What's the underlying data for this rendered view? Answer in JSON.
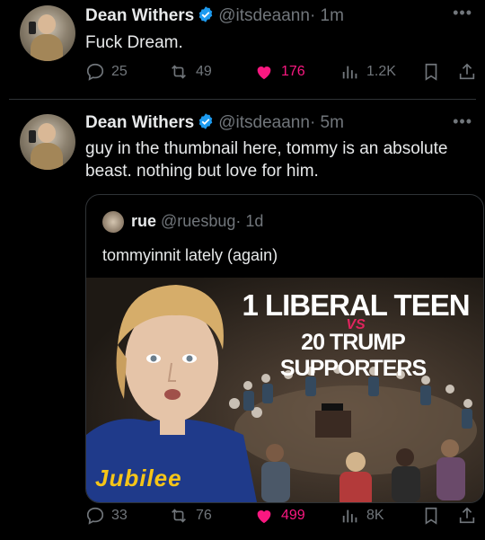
{
  "tweets": [
    {
      "name": "Dean Withers",
      "handle": "@itsdeaann",
      "time": "· 1m",
      "text": "Fuck Dream.",
      "replies": "25",
      "reposts": "49",
      "likes": "176",
      "views": "1.2K",
      "liked": true
    },
    {
      "name": "Dean Withers",
      "handle": "@itsdeaann",
      "time": "· 5m",
      "text": "guy in the thumbnail here, tommy is an absolute beast. nothing but love for him.",
      "replies": "33",
      "reposts": "76",
      "likes": "499",
      "views": "8K",
      "liked": true,
      "quote": {
        "name": "rue",
        "handle": "@ruesbug",
        "time": "· 1d",
        "text": "tommyinnit lately (again)",
        "thumbnail": {
          "line1": "1 LIBERAL TEEN",
          "vs": "VS",
          "line2": "20 TRUMP SUPPORTERS",
          "brand": "Jubilee"
        }
      }
    }
  ],
  "colors": {
    "background": "#000000",
    "text": "#e7e9ea",
    "muted": "#71767b",
    "like": "#f91880",
    "verified": "#1d9bf0",
    "border": "#2f3336"
  },
  "icons": [
    "reply-icon",
    "repost-icon",
    "heart-icon",
    "views-icon",
    "bookmark-icon",
    "share-icon",
    "verified-icon",
    "more-icon"
  ]
}
